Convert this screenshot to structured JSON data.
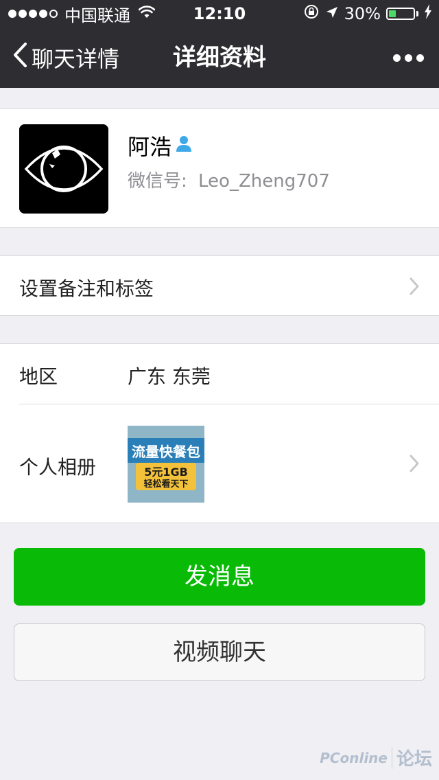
{
  "status_bar": {
    "carrier": "中国联通",
    "time": "12:10",
    "battery": "30%",
    "battery_level": 0.3
  },
  "nav": {
    "back_label": "聊天详情",
    "title": "详细资料"
  },
  "profile": {
    "name": "阿浩",
    "wechat_id_label": "微信号:",
    "wechat_id": "Leo_Zheng707"
  },
  "remark_row": {
    "label": "设置备注和标签"
  },
  "info": {
    "region_label": "地区",
    "region_value": "广东  东莞",
    "album_label": "个人相册",
    "album_thumb": {
      "line1": "流量快餐包",
      "line2": "5元1GB",
      "line3": "轻松看天下"
    }
  },
  "actions": {
    "send_message": "发消息",
    "video_call": "视频聊天"
  },
  "watermark": {
    "brand": "PConline",
    "forum": "论坛"
  },
  "colors": {
    "nav_bg": "#2e2e32",
    "primary_green": "#09bb07",
    "page_bg": "#efeff4"
  }
}
